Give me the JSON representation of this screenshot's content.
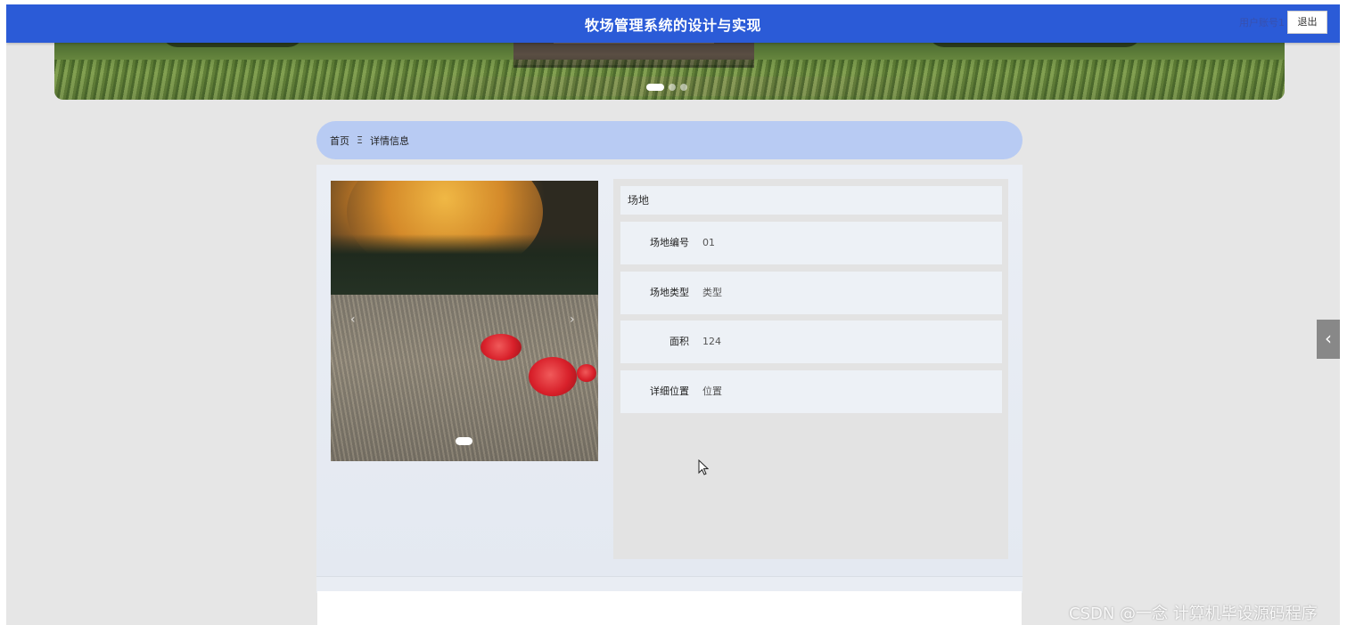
{
  "header": {
    "title": "牧场管理系统的设计与实现",
    "username": "用户账号1",
    "logout_label": "退出",
    "bg_color": "#2b5bd7"
  },
  "banner": {
    "slide_count": 3,
    "active_slide": 1
  },
  "breadcrumb": {
    "home": "首页",
    "separator": "Ξ",
    "current": "详情信息"
  },
  "gallery": {
    "prev_icon": "‹",
    "next_icon": "›",
    "slide_count": 1,
    "active_slide": 1
  },
  "detail": {
    "title": "场地",
    "fields": [
      {
        "label": "场地编号",
        "value": "01"
      },
      {
        "label": "场地类型",
        "value": "类型"
      },
      {
        "label": "面积",
        "value": "124"
      },
      {
        "label": "详细位置",
        "value": "位置"
      }
    ]
  },
  "side_toggle": {
    "icon": "‹"
  },
  "watermark": "CSDN @一念 计算机毕设源码程序"
}
